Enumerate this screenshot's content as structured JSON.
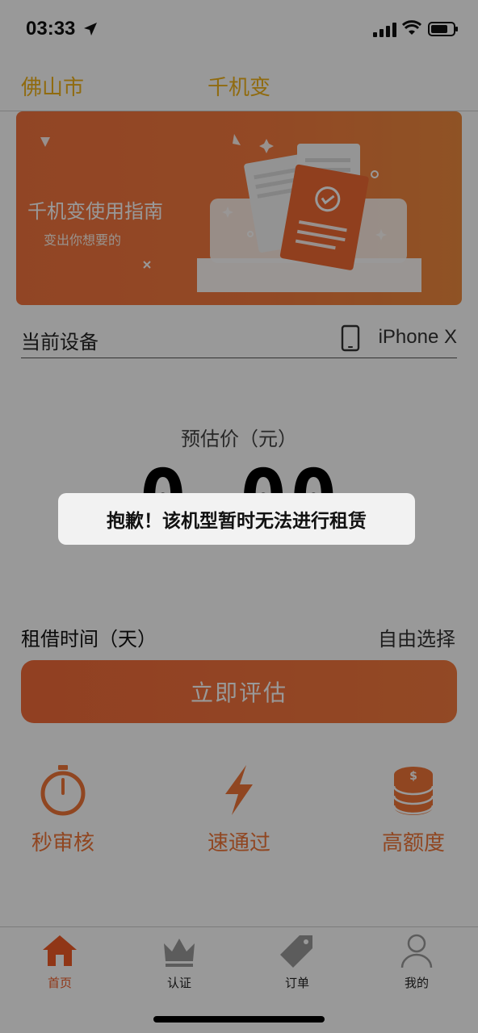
{
  "status_bar": {
    "time": "03:33",
    "icons": [
      "location-arrow-icon",
      "signal-icon",
      "wifi-icon",
      "battery-icon"
    ]
  },
  "nav": {
    "city": "佛山市",
    "title": "千机变",
    "accent_color": "#f0b21a"
  },
  "banner": {
    "title": "千机变使用指南",
    "subtitle": "变出你想要的",
    "gradient": [
      "#f2743e",
      "#ef8a3f"
    ]
  },
  "device": {
    "label": "当前设备",
    "icon": "phone-icon",
    "value": "iPhone X"
  },
  "price": {
    "label": "预估价（元）",
    "value": "0.00"
  },
  "rent": {
    "label": "租借时间（天）",
    "value": "自由选择"
  },
  "evaluate_button": {
    "label": "立即评估",
    "color": "#f26b3a"
  },
  "features": [
    {
      "icon": "stopwatch-icon",
      "label": "秒审核"
    },
    {
      "icon": "lightning-icon",
      "label": "速通过"
    },
    {
      "icon": "coins-icon",
      "label": "高额度"
    }
  ],
  "tabs": [
    {
      "icon": "home-icon",
      "label": "首页",
      "active": true
    },
    {
      "icon": "crown-icon",
      "label": "认证",
      "active": false
    },
    {
      "icon": "tag-icon",
      "label": "订单",
      "active": false
    },
    {
      "icon": "user-icon",
      "label": "我的",
      "active": false
    }
  ],
  "toast": {
    "message": "抱歉！该机型暂时无法进行租赁"
  }
}
